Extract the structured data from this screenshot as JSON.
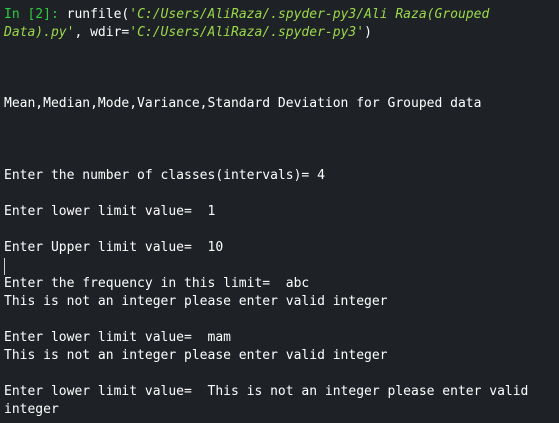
{
  "console": {
    "prompt": {
      "label": "In [2]:",
      "func": " runfile(",
      "path1_a": "'C:/Users/AliRaza/.spyder-py3/Ali Raza(Grouped",
      "path1_b": "Data).py'",
      "sep": ", wdir=",
      "path2": "'C:/Users/AliRaza/.spyder-py3'",
      "close": ")"
    },
    "lines": [
      "Mean,Median,Mode,Variance,Standard Deviation for Grouped data",
      "Enter the number of classes(intervals)= 4",
      "Enter lower limit value=  1",
      "Enter Upper limit value=  10",
      "Enter the frequency in this limit=  abc",
      "This is not an integer please enter valid integer",
      "Enter lower limit value=  mam",
      "This is not an integer please enter valid integer",
      "Enter lower limit value=  This is not an integer please enter valid",
      "integer"
    ]
  }
}
